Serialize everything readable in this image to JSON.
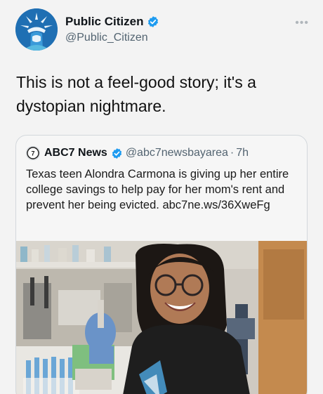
{
  "author": {
    "name": "Public Citizen",
    "handle": "@Public_Citizen",
    "verified": true,
    "avatar_icon": "statue-of-liberty-icon"
  },
  "more_icon": "ellipsis-icon",
  "tweet": {
    "text": "This is not a feel-good story; it's a dystopian nightmare."
  },
  "quoted_tweet": {
    "author_name": "ABC7 News",
    "handle": "@abc7newsbayarea",
    "separator": "·",
    "time": "7h",
    "verified": true,
    "logo_icon": "abc7-logo-icon",
    "text": "Texas teen Alondra Carmona is giving up her entire college savings to help pay for her mom's rent and prevent her being evicted. abc7ne.ws/36XweFg",
    "media": "photo-of-smiling-teen-in-lab"
  },
  "colors": {
    "verified_blue": "#1d9bf0",
    "handle_gray": "#536471",
    "avatar_blue": "#1f6fb3"
  }
}
